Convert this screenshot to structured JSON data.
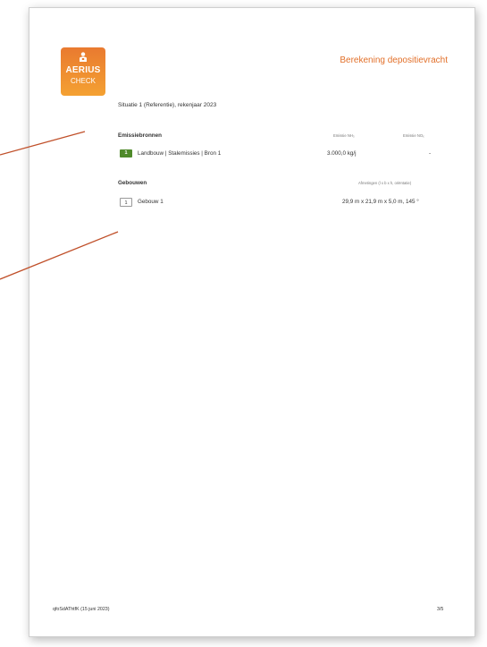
{
  "brand": {
    "logo_text": "AERIUS",
    "logo_sub": "CHECK",
    "logo_colors": [
      "#e97a30",
      "#f4a132"
    ],
    "logo_icon": "person-icon"
  },
  "header": {
    "title": "Berekening depositievracht",
    "title_color": "#e2702a"
  },
  "situation": {
    "title": "Situatie 1 (Referentie), rekenjaar 2023"
  },
  "emissions": {
    "section_title": "Emissiebronnen",
    "col_nh3": "Emissie NH₃",
    "col_nox": "Emissie NOₓ",
    "rows": [
      {
        "badge": "1",
        "name": "Landbouw | Stalemissies | Bron 1",
        "nh3": "3.000,0 kg/j",
        "nox": "-"
      }
    ],
    "badge_color": "#4f8a2a"
  },
  "buildings": {
    "section_title": "Gebouwen",
    "col_dimensions": "Afmetingen (l x b x h, oriëntatie)",
    "rows": [
      {
        "badge": "1",
        "name": "Gebouw 1",
        "dims": "29,9 m x 21,9 m x 5,0 m, 145 °"
      }
    ]
  },
  "footer": {
    "reference": "qfoSdAThtfK (15 juni 2023)",
    "page": "3/5"
  },
  "callout_color": "#c0502a"
}
